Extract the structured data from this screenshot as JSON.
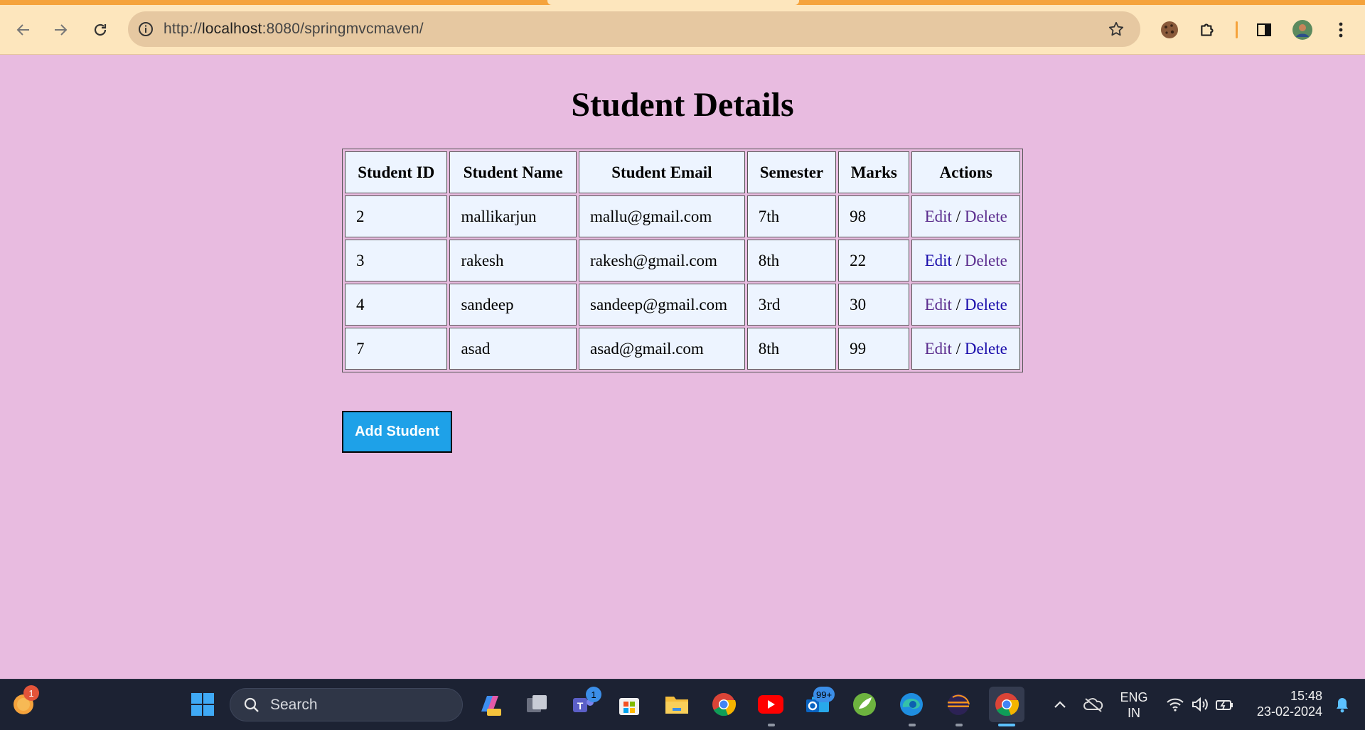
{
  "browser": {
    "url_scheme": "http://",
    "url_host": "localhost",
    "url_rest": ":8080/springmvcmaven/",
    "colors": {
      "frame": "#fde6bd",
      "accent": "#f5a33c",
      "omnibox": "#e6c8a1"
    }
  },
  "page": {
    "title": "Student Details",
    "background": "#e8bbe0",
    "table": {
      "headers": [
        "Student ID",
        "Student Name",
        "Student Email",
        "Semester",
        "Marks",
        "Actions"
      ],
      "rows": [
        {
          "id": "2",
          "name": "mallikarjun",
          "email": "mallu@gmail.com",
          "semester": "7th",
          "marks": "98",
          "edit": "Edit",
          "sep": "/",
          "delete": "Delete"
        },
        {
          "id": "3",
          "name": "rakesh",
          "email": "rakesh@gmail.com",
          "semester": "8th",
          "marks": "22",
          "edit": "Edit",
          "sep": "/",
          "delete": "Delete"
        },
        {
          "id": "4",
          "name": "sandeep",
          "email": "sandeep@gmail.com",
          "semester": "3rd",
          "marks": "30",
          "edit": "Edit",
          "sep": "/",
          "delete": "Delete"
        },
        {
          "id": "7",
          "name": "asad",
          "email": "asad@gmail.com",
          "semester": "8th",
          "marks": "99",
          "edit": "Edit",
          "sep": "/",
          "delete": "Delete"
        }
      ]
    },
    "add_button": "Add Student"
  },
  "taskbar": {
    "search_placeholder": "Search",
    "notification_badge": "1",
    "teams_badge": "1",
    "outlook_badge": "99+",
    "lang_line1": "ENG",
    "lang_line2": "IN",
    "time": "15:48",
    "date": "23-02-2024"
  }
}
